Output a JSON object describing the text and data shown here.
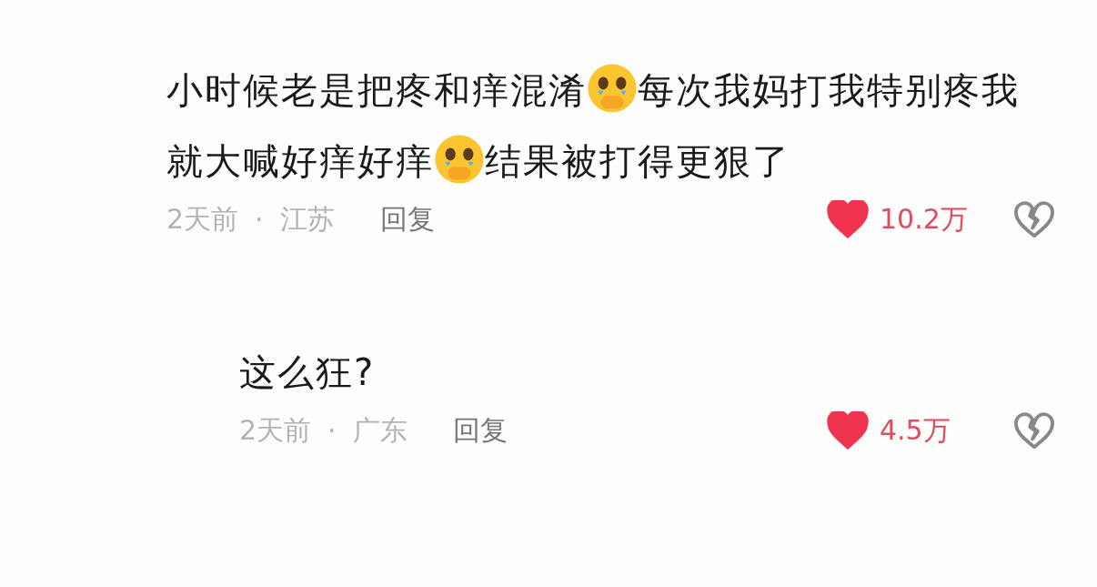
{
  "comments": [
    {
      "content": [
        {
          "kind": "text",
          "text": "小时候老是把疼和痒混淆"
        },
        {
          "kind": "emoji"
        },
        {
          "kind": "text",
          "text": "每次我妈打我特别疼我"
        },
        {
          "kind": "text",
          "text": "就大喊好痒好痒"
        },
        {
          "kind": "emoji"
        },
        {
          "kind": "text",
          "text": "结果被打得更狠了"
        }
      ],
      "time": "2天前",
      "separator": "·",
      "location": "江苏",
      "reply": "回复",
      "liked": true,
      "likes": "10.2万",
      "reply_level": false
    },
    {
      "content": [
        {
          "kind": "text",
          "text": "这么狂?"
        }
      ],
      "time": "2天前",
      "separator": "·",
      "location": "广东",
      "reply": "回复",
      "liked": true,
      "likes": "4.5万",
      "reply_level": true
    }
  ]
}
